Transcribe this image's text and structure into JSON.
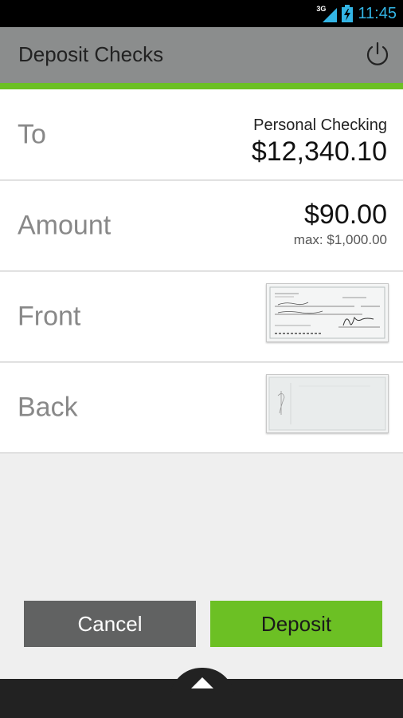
{
  "status_bar": {
    "network": "3G",
    "time": "11:45",
    "signal_icon": "signal-icon",
    "battery_icon": "battery-charging-icon"
  },
  "header": {
    "title": "Deposit Checks",
    "power_icon": "power-icon",
    "accent_color": "#6cc024"
  },
  "rows": {
    "to": {
      "label": "To",
      "account_name": "Personal Checking",
      "balance": "$12,340.10"
    },
    "amount": {
      "label": "Amount",
      "value": "$90.00",
      "max": "max: $1,000.00"
    },
    "front": {
      "label": "Front"
    },
    "back": {
      "label": "Back"
    }
  },
  "actions": {
    "cancel_label": "Cancel",
    "deposit_label": "Deposit"
  },
  "bottom_bar": {
    "expand_icon": "chevron-up-icon"
  }
}
